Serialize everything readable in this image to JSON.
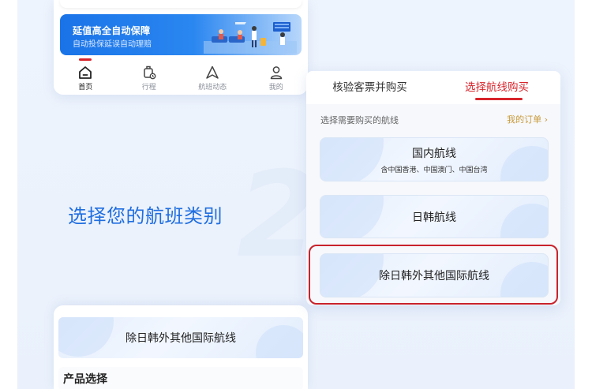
{
  "banner": {
    "title": "延值高全自动保障",
    "subtitle": "自动投保延误自动理赔"
  },
  "tabbar": {
    "items": [
      {
        "label": "首页",
        "icon": "home-icon",
        "active": true
      },
      {
        "label": "行程",
        "icon": "luggage-icon",
        "active": false
      },
      {
        "label": "航班动态",
        "icon": "flight-status-icon",
        "active": false
      },
      {
        "label": "我的",
        "icon": "user-icon",
        "active": false
      }
    ]
  },
  "step": {
    "number": "2",
    "headline": "选择您的航班类别"
  },
  "panel": {
    "tabs": [
      {
        "label": "核验客票并购买",
        "active": false
      },
      {
        "label": "选择航线购买",
        "active": true
      }
    ],
    "subtitle": "选择需要购买的航线",
    "orders_link": "我的订单 ›",
    "routes": [
      {
        "name": "国内航线",
        "note": "含中国香港、中国澳门、中国台湾"
      },
      {
        "name": "日韩航线",
        "note": ""
      },
      {
        "name": "除日韩外其他国际航线",
        "note": ""
      }
    ]
  },
  "bottom": {
    "selected_route": "除日韩外其他国际航线",
    "section_title": "产品选择"
  },
  "colors": {
    "accent_red": "#d8232a",
    "brand_blue": "#1f6ee0",
    "link_gold": "#c99a3a"
  }
}
